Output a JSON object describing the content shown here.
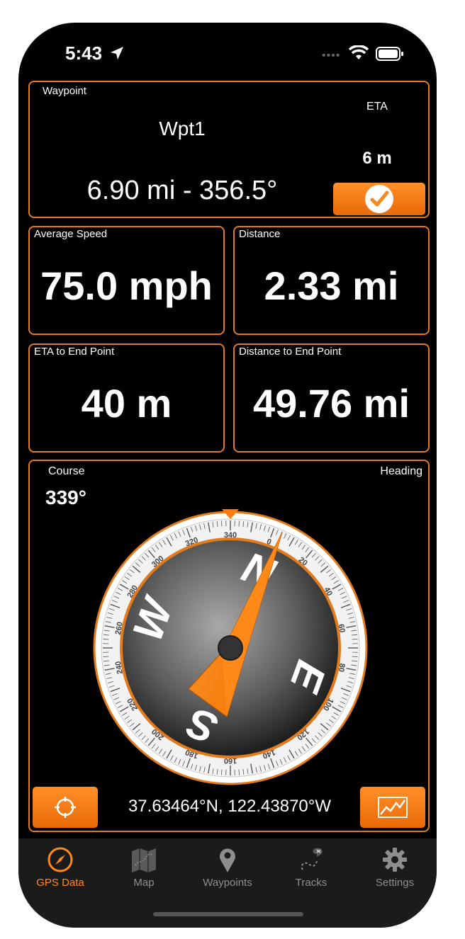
{
  "status_bar": {
    "time": "5:43"
  },
  "waypoint_panel": {
    "label": "Waypoint",
    "name": "Wpt1",
    "eta_label": "ETA",
    "eta_value": "6 m",
    "distance_bearing": "6.90 mi - 356.5°"
  },
  "tiles": {
    "average_speed": {
      "label": "Average Speed",
      "value": "75.0 mph"
    },
    "distance": {
      "label": "Distance",
      "value": "2.33 mi"
    },
    "eta_end": {
      "label": "ETA to End Point",
      "value": "40 m"
    },
    "distance_end": {
      "label": "Distance to End Point",
      "value": "49.76 mi"
    }
  },
  "compass_panel": {
    "course_label": "Course",
    "course_value": "339°",
    "heading_label": "Heading",
    "coordinates": "37.63464°N, 122.43870°W",
    "dial_numbers": [
      "0",
      "20",
      "40",
      "60",
      "80",
      "100",
      "120",
      "140",
      "160",
      "180",
      "200",
      "220",
      "240",
      "260",
      "280",
      "300",
      "320",
      "340"
    ],
    "cardinals": {
      "n": "N",
      "e": "E",
      "s": "S",
      "w": "W"
    }
  },
  "tab_bar": {
    "items": [
      {
        "label": "GPS Data",
        "icon": "compass-icon",
        "active": true
      },
      {
        "label": "Map",
        "icon": "map-icon",
        "active": false
      },
      {
        "label": "Waypoints",
        "icon": "pin-icon",
        "active": false
      },
      {
        "label": "Tracks",
        "icon": "tracks-icon",
        "active": false
      },
      {
        "label": "Settings",
        "icon": "gear-icon",
        "active": false
      }
    ]
  },
  "colors": {
    "accent": "#ff8a1c",
    "border": "#e27a1e",
    "background": "#000000"
  }
}
